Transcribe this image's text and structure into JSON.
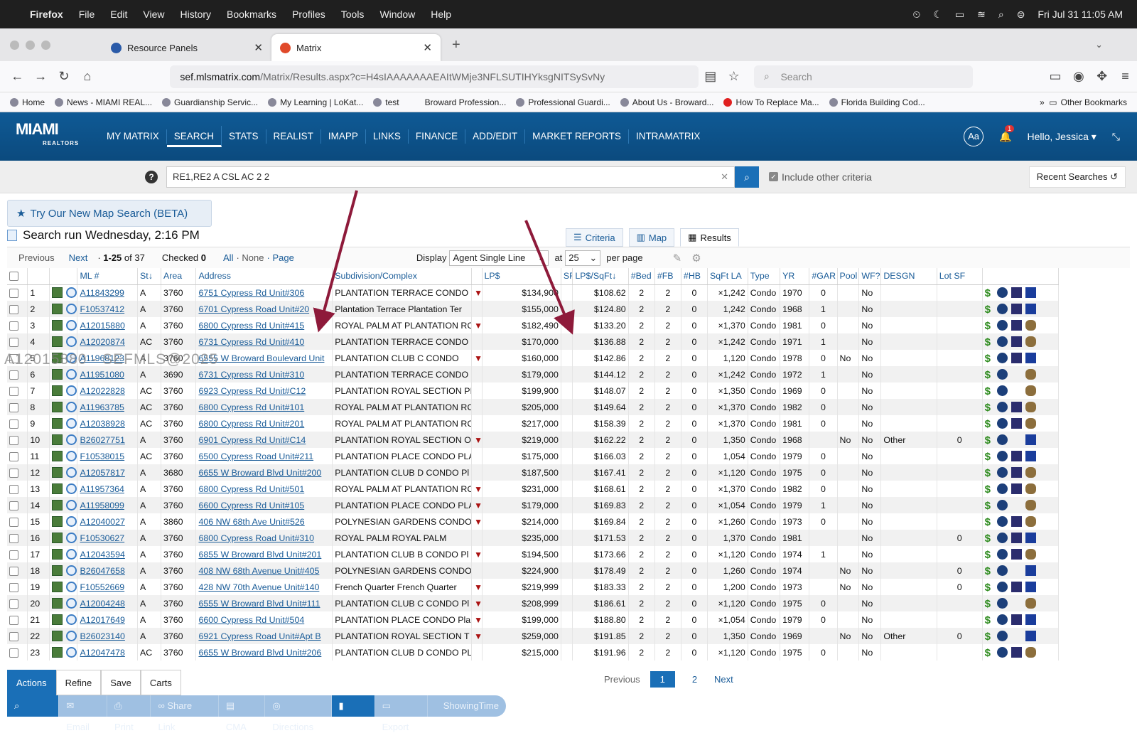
{
  "menubar": {
    "app": "Firefox",
    "items": [
      "File",
      "Edit",
      "View",
      "History",
      "Bookmarks",
      "Profiles",
      "Tools",
      "Window",
      "Help"
    ],
    "clock": "Fri Jul 31  11:05 AM"
  },
  "tabs": [
    {
      "label": "Resource Panels"
    },
    {
      "label": "Matrix"
    }
  ],
  "url": {
    "host": "sef.mlsmatrix.com",
    "path": "/Matrix/Results.aspx?c=H4sIAAAAAAAEAItWMje3NFLSUTIHYksgNITSySvNy"
  },
  "search_placeholder": "Search",
  "bookmarks": [
    "Home",
    "News - MIAMI REAL...",
    "Guardianship Servic...",
    "My Learning | LoKat...",
    "test",
    "Broward Profession...",
    "Professional Guardi...",
    "About Us - Broward...",
    "How To Replace Ma...",
    "Florida Building Cod...",
    "Other Bookmarks"
  ],
  "app": {
    "logo": "MIAMI",
    "logo_sub": "REALTORS",
    "nav": [
      "MY MATRIX",
      "SEARCH",
      "STATS",
      "REALIST",
      "IMAPP",
      "LINKS",
      "FINANCE",
      "ADD/EDIT",
      "MARKET REPORTS",
      "INTRAMATRIX"
    ],
    "aa": "Aa",
    "badge": "1",
    "greeting": "Hello, Jessica ▾"
  },
  "query": {
    "value": "RE1,RE2 A CSL AC 2 2",
    "include_label": "Include other criteria",
    "recent": "Recent Searches"
  },
  "map_search": "Try Our New Map Search (BETA)",
  "run_info": "Search run Wednesday, 2:16 PM",
  "view_tabs": [
    "Criteria",
    "Map",
    "Results"
  ],
  "pager": {
    "prev": "Previous",
    "next": "Next",
    "range": "1-25",
    "of": "of 37",
    "checked_label": "Checked",
    "checked": "0",
    "all": "All",
    "none": "None",
    "page": "Page",
    "display_label": "Display",
    "display": "Agent Single Line",
    "at": "at",
    "per": "25",
    "per_page": "per page"
  },
  "columns": [
    "ML #",
    "St",
    "Area",
    "Address",
    "Subdivision/Complex",
    "LP$",
    "SF",
    "LP$/SqFt",
    "#Bed",
    "#FB",
    "#HB",
    "SqFt LA",
    "Type",
    "YR",
    "#GAR",
    "Pool",
    "WF?",
    "DESGN",
    "Lot SF"
  ],
  "rows": [
    [
      "1",
      "A11843299",
      "A",
      "3760",
      "6751 Cypress Rd Unit#306",
      "PLANTATION TERRACE CONDO I",
      "$134,900",
      "$108.62",
      "2",
      "2",
      "0",
      "×1,242",
      "Condo",
      "1970",
      "0",
      "",
      "No",
      "",
      ""
    ],
    [
      "2",
      "F10537412",
      "A",
      "3760",
      "6701 Cypress Road Unit#20",
      "Plantation Terrace Plantation Ter",
      "$155,000",
      "$124.80",
      "2",
      "2",
      "0",
      "1,242",
      "Condo",
      "1968",
      "1",
      "",
      "No",
      "",
      ""
    ],
    [
      "3",
      "A12015880",
      "A",
      "3760",
      "6800 Cypress Rd Unit#415",
      "ROYAL PALM AT PLANTATION RC",
      "$182,490",
      "$133.20",
      "2",
      "2",
      "0",
      "×1,370",
      "Condo",
      "1981",
      "0",
      "",
      "No",
      "",
      ""
    ],
    [
      "4",
      "A12020874",
      "AC",
      "3760",
      "6731 Cypress Rd Unit#410",
      "PLANTATION TERRACE CONDO I",
      "$170,000",
      "$136.88",
      "2",
      "2",
      "0",
      "×1,242",
      "Condo",
      "1971",
      "1",
      "",
      "No",
      "",
      ""
    ],
    [
      "5",
      "A11968123",
      "A",
      "3760",
      "6555 W Broward Boulevard Unit",
      "PLANTATION CLUB C CONDO",
      "$160,000",
      "$142.86",
      "2",
      "2",
      "0",
      "1,120",
      "Condo",
      "1978",
      "0",
      "No",
      "No",
      "",
      ""
    ],
    [
      "6",
      "A11951080",
      "A",
      "3690",
      "6731 Cypress Rd Unit#310",
      "PLANTATION TERRACE CONDO I",
      "$179,000",
      "$144.12",
      "2",
      "2",
      "0",
      "×1,242",
      "Condo",
      "1972",
      "1",
      "",
      "No",
      "",
      ""
    ],
    [
      "7",
      "A12022828",
      "AC",
      "3760",
      "6923 Cypress Rd Unit#C12",
      "PLANTATION ROYAL SECTION PI",
      "$199,900",
      "$148.07",
      "2",
      "2",
      "0",
      "×1,350",
      "Condo",
      "1969",
      "0",
      "",
      "No",
      "",
      ""
    ],
    [
      "8",
      "A11963785",
      "AC",
      "3760",
      "6800 Cypress Rd Unit#101",
      "ROYAL PALM AT PLANTATION RC",
      "$205,000",
      "$149.64",
      "2",
      "2",
      "0",
      "×1,370",
      "Condo",
      "1982",
      "0",
      "",
      "No",
      "",
      ""
    ],
    [
      "9",
      "A12038928",
      "AC",
      "3760",
      "6800 Cypress Rd Unit#201",
      "ROYAL PALM AT PLANTATION RC",
      "$217,000",
      "$158.39",
      "2",
      "2",
      "0",
      "×1,370",
      "Condo",
      "1981",
      "0",
      "",
      "No",
      "",
      ""
    ],
    [
      "10",
      "B26027751",
      "A",
      "3760",
      "6901 Cypress Rd Unit#C14",
      "PLANTATION ROYAL SECTION O",
      "$219,000",
      "$162.22",
      "2",
      "2",
      "0",
      "1,350",
      "Condo",
      "1968",
      "",
      "No",
      "No",
      "Other",
      "0"
    ],
    [
      "11",
      "F10538015",
      "AC",
      "3760",
      "6500 Cypress Road Unit#211",
      "PLANTATION PLACE CONDO PLA",
      "$175,000",
      "$166.03",
      "2",
      "2",
      "0",
      "1,054",
      "Condo",
      "1979",
      "0",
      "",
      "No",
      "",
      ""
    ],
    [
      "12",
      "A12057817",
      "A",
      "3680",
      "6655 W Broward Blvd Unit#200",
      "PLANTATION CLUB D CONDO Pl",
      "$187,500",
      "$167.41",
      "2",
      "2",
      "0",
      "×1,120",
      "Condo",
      "1975",
      "0",
      "",
      "No",
      "",
      ""
    ],
    [
      "13",
      "A11957364",
      "A",
      "3760",
      "6800 Cypress Rd Unit#501",
      "ROYAL PALM AT PLANTATION RC",
      "$231,000",
      "$168.61",
      "2",
      "2",
      "0",
      "×1,370",
      "Condo",
      "1982",
      "0",
      "",
      "No",
      "",
      ""
    ],
    [
      "14",
      "A11958099",
      "A",
      "3760",
      "6600 Cypress Rd Unit#105",
      "PLANTATION PLACE CONDO PLA",
      "$179,000",
      "$169.83",
      "2",
      "2",
      "0",
      "×1,054",
      "Condo",
      "1979",
      "1",
      "",
      "No",
      "",
      ""
    ],
    [
      "15",
      "A12040027",
      "A",
      "3860",
      "406 NW 68th Ave Unit#526",
      "POLYNESIAN GARDENS CONDO",
      "$214,000",
      "$169.84",
      "2",
      "2",
      "0",
      "×1,260",
      "Condo",
      "1973",
      "0",
      "",
      "No",
      "",
      ""
    ],
    [
      "16",
      "F10530627",
      "A",
      "3760",
      "6800 Cypress Road Unit#310",
      "ROYAL PALM ROYAL PALM",
      "$235,000",
      "$171.53",
      "2",
      "2",
      "0",
      "1,370",
      "Condo",
      "1981",
      "",
      "",
      "No",
      "",
      "0"
    ],
    [
      "17",
      "A12043594",
      "A",
      "3760",
      "6855 W Broward Blvd Unit#201",
      "PLANTATION CLUB B CONDO Pl",
      "$194,500",
      "$173.66",
      "2",
      "2",
      "0",
      "×1,120",
      "Condo",
      "1974",
      "1",
      "",
      "No",
      "",
      ""
    ],
    [
      "18",
      "B26047658",
      "A",
      "3760",
      "408 NW 68th Avenue Unit#405",
      "POLYNESIAN GARDENS CONDO",
      "$224,900",
      "$178.49",
      "2",
      "2",
      "0",
      "1,260",
      "Condo",
      "1974",
      "",
      "No",
      "No",
      "",
      "0"
    ],
    [
      "19",
      "F10552669",
      "A",
      "3760",
      "428 NW 70th Avenue Unit#140",
      "French Quarter French Quarter",
      "$219,999",
      "$183.33",
      "2",
      "2",
      "0",
      "1,200",
      "Condo",
      "1973",
      "",
      "No",
      "No",
      "",
      "0"
    ],
    [
      "20",
      "A12004248",
      "A",
      "3760",
      "6555 W Broward Blvd Unit#111",
      "PLANTATION CLUB C CONDO Pl",
      "$208,999",
      "$186.61",
      "2",
      "2",
      "0",
      "×1,120",
      "Condo",
      "1975",
      "0",
      "",
      "No",
      "",
      ""
    ],
    [
      "21",
      "A12017649",
      "A",
      "3760",
      "6600 Cypress Rd Unit#504",
      "PLANTATION PLACE CONDO Pla",
      "$199,000",
      "$188.80",
      "2",
      "2",
      "0",
      "×1,054",
      "Condo",
      "1979",
      "0",
      "",
      "No",
      "",
      ""
    ],
    [
      "22",
      "B26023140",
      "A",
      "3760",
      "6921 Cypress Road Unit#Apt B",
      "PLANTATION ROYAL SECTION T",
      "$259,000",
      "$191.85",
      "2",
      "2",
      "0",
      "1,350",
      "Condo",
      "1969",
      "",
      "No",
      "No",
      "Other",
      "0"
    ],
    [
      "23",
      "A12047478",
      "AC",
      "3760",
      "6655 W Broward Blvd Unit#206",
      "PLANTATION CLUB D CONDO PL",
      "$215,000",
      "$191.96",
      "2",
      "2",
      "0",
      "×1,120",
      "Condo",
      "1975",
      "0",
      "",
      "No",
      "",
      ""
    ]
  ],
  "watermark": "A12015880 - SEFMLS@2025",
  "actions": {
    "tabs": [
      "Actions",
      "Refine",
      "Save",
      "Carts"
    ],
    "tools": [
      "Criteria",
      "Email",
      "Print",
      "Share Link",
      "CMA",
      "Directions",
      "Stats",
      "Export",
      "ShowingTime"
    ]
  },
  "pages": {
    "prev": "Previous",
    "p1": "1",
    "p2": "2",
    "next": "Next"
  }
}
